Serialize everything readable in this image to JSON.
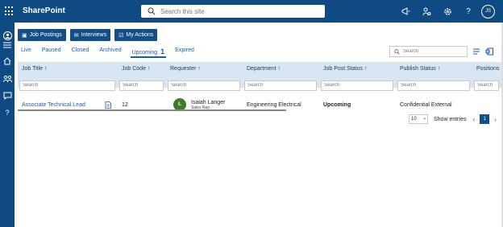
{
  "app": {
    "title": "SharePoint"
  },
  "search": {
    "placeholder": "Search this site"
  },
  "user": {
    "initials": "JS"
  },
  "toolbar": {
    "job_postings": "Job Postings",
    "interviews": "Interviews",
    "my_actions": "My Actions"
  },
  "tabs": [
    "Live",
    "Paused",
    "Closed",
    "Archived",
    "Upcoming",
    "Expired"
  ],
  "active_tab_count": "1",
  "grid_search": {
    "placeholder": "Search"
  },
  "columns": [
    "Job Title ↑",
    "Job Code ↑",
    "Requester ↑",
    "Department ↑",
    "Job Post Status ↑",
    "Publish Status ↑",
    "Positions"
  ],
  "filter_placeholder": "Search",
  "rows": [
    {
      "job_title": "Associate Technical Lead",
      "job_code": "12",
      "requester_initials": "IL",
      "requester_name": "Isaiah Langer",
      "requester_role": "Sales Rep",
      "department": "Engineering Electrical",
      "job_post_status": "Upcoming",
      "publish_status": "Confidential External"
    }
  ],
  "pager": {
    "page_size": "10",
    "label": "Show entries",
    "current_page": "1"
  },
  "colors": {
    "brand": "#0f4a82",
    "header_bg": "#d8e6f3",
    "link": "#1b5ea8",
    "avatar": "#3c7f2a"
  }
}
